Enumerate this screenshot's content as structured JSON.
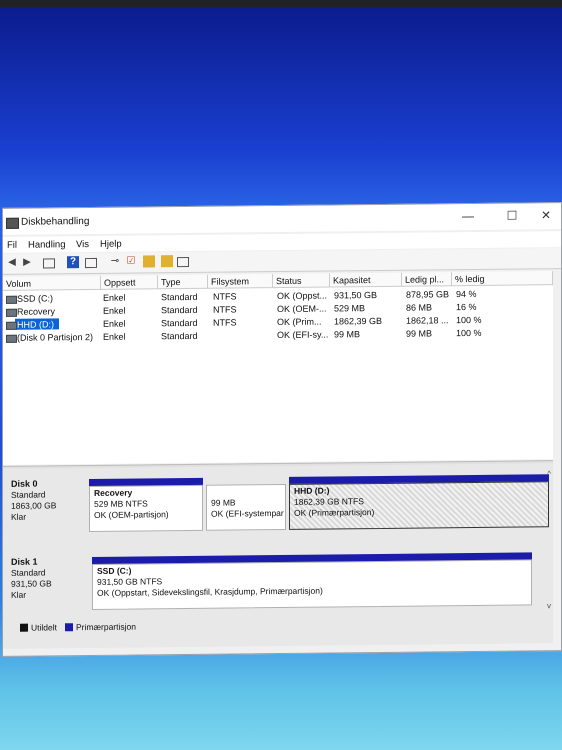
{
  "window": {
    "title": "Diskbehandling",
    "controls": {
      "minimize": "—",
      "maximize": "☐",
      "close": "✕"
    }
  },
  "menu": [
    "Fil",
    "Handling",
    "Vis",
    "Hjelp"
  ],
  "toolbar_icons": [
    "back-icon",
    "forward-icon",
    "console-tree-icon",
    "help-icon",
    "properties-icon",
    "connect-icon",
    "check-icon",
    "folder-icon",
    "folder-search-icon",
    "view-icon"
  ],
  "columns": [
    "Volum",
    "Oppsett",
    "Type",
    "Filsystem",
    "Status",
    "Kapasitet",
    "Ledig pl...",
    "% ledig"
  ],
  "volumes": [
    {
      "name": "SSD (C:)",
      "layout": "Enkel",
      "type": "Standard",
      "fs": "NTFS",
      "status": "OK (Oppst...",
      "capacity": "931,50 GB",
      "free": "878,95 GB",
      "pct": "94 %"
    },
    {
      "name": "Recovery",
      "layout": "Enkel",
      "type": "Standard",
      "fs": "NTFS",
      "status": "OK (OEM-...",
      "capacity": "529 MB",
      "free": "86 MB",
      "pct": "16 %"
    },
    {
      "name": "HHD (D:)",
      "layout": "Enkel",
      "type": "Standard",
      "fs": "NTFS",
      "status": "OK (Prim...",
      "capacity": "1862,39 GB",
      "free": "1862,18 ...",
      "pct": "100 %"
    },
    {
      "name": "(Disk 0 Partisjon 2)",
      "layout": "Enkel",
      "type": "Standard",
      "fs": "",
      "status": "OK (EFI-sy...",
      "capacity": "99 MB",
      "free": "99 MB",
      "pct": "100 %"
    }
  ],
  "disks": [
    {
      "name": "Disk 0",
      "type": "Standard",
      "size": "1863,00 GB",
      "state": "Klar",
      "partitions": [
        {
          "title": "Recovery",
          "line1": "529 MB NTFS",
          "line2": "OK (OEM-partisjon)"
        },
        {
          "title": "",
          "line1": "99 MB",
          "line2": "OK (EFI-systempar"
        },
        {
          "title": "HHD  (D:)",
          "line1": "1862,39 GB NTFS",
          "line2": "OK (Primærpartisjon)"
        }
      ]
    },
    {
      "name": "Disk 1",
      "type": "Standard",
      "size": "931,50 GB",
      "state": "Klar",
      "partitions": [
        {
          "title": "SSD  (C:)",
          "line1": "931,50 GB NTFS",
          "line2": "OK (Oppstart, Sidevekslingsfil, Krasjdump, Primærpartisjon)"
        }
      ]
    }
  ],
  "legend": [
    {
      "label": "Utildelt",
      "color": "#111111"
    },
    {
      "label": "Primærpartisjon",
      "color": "#1c1caa"
    }
  ]
}
